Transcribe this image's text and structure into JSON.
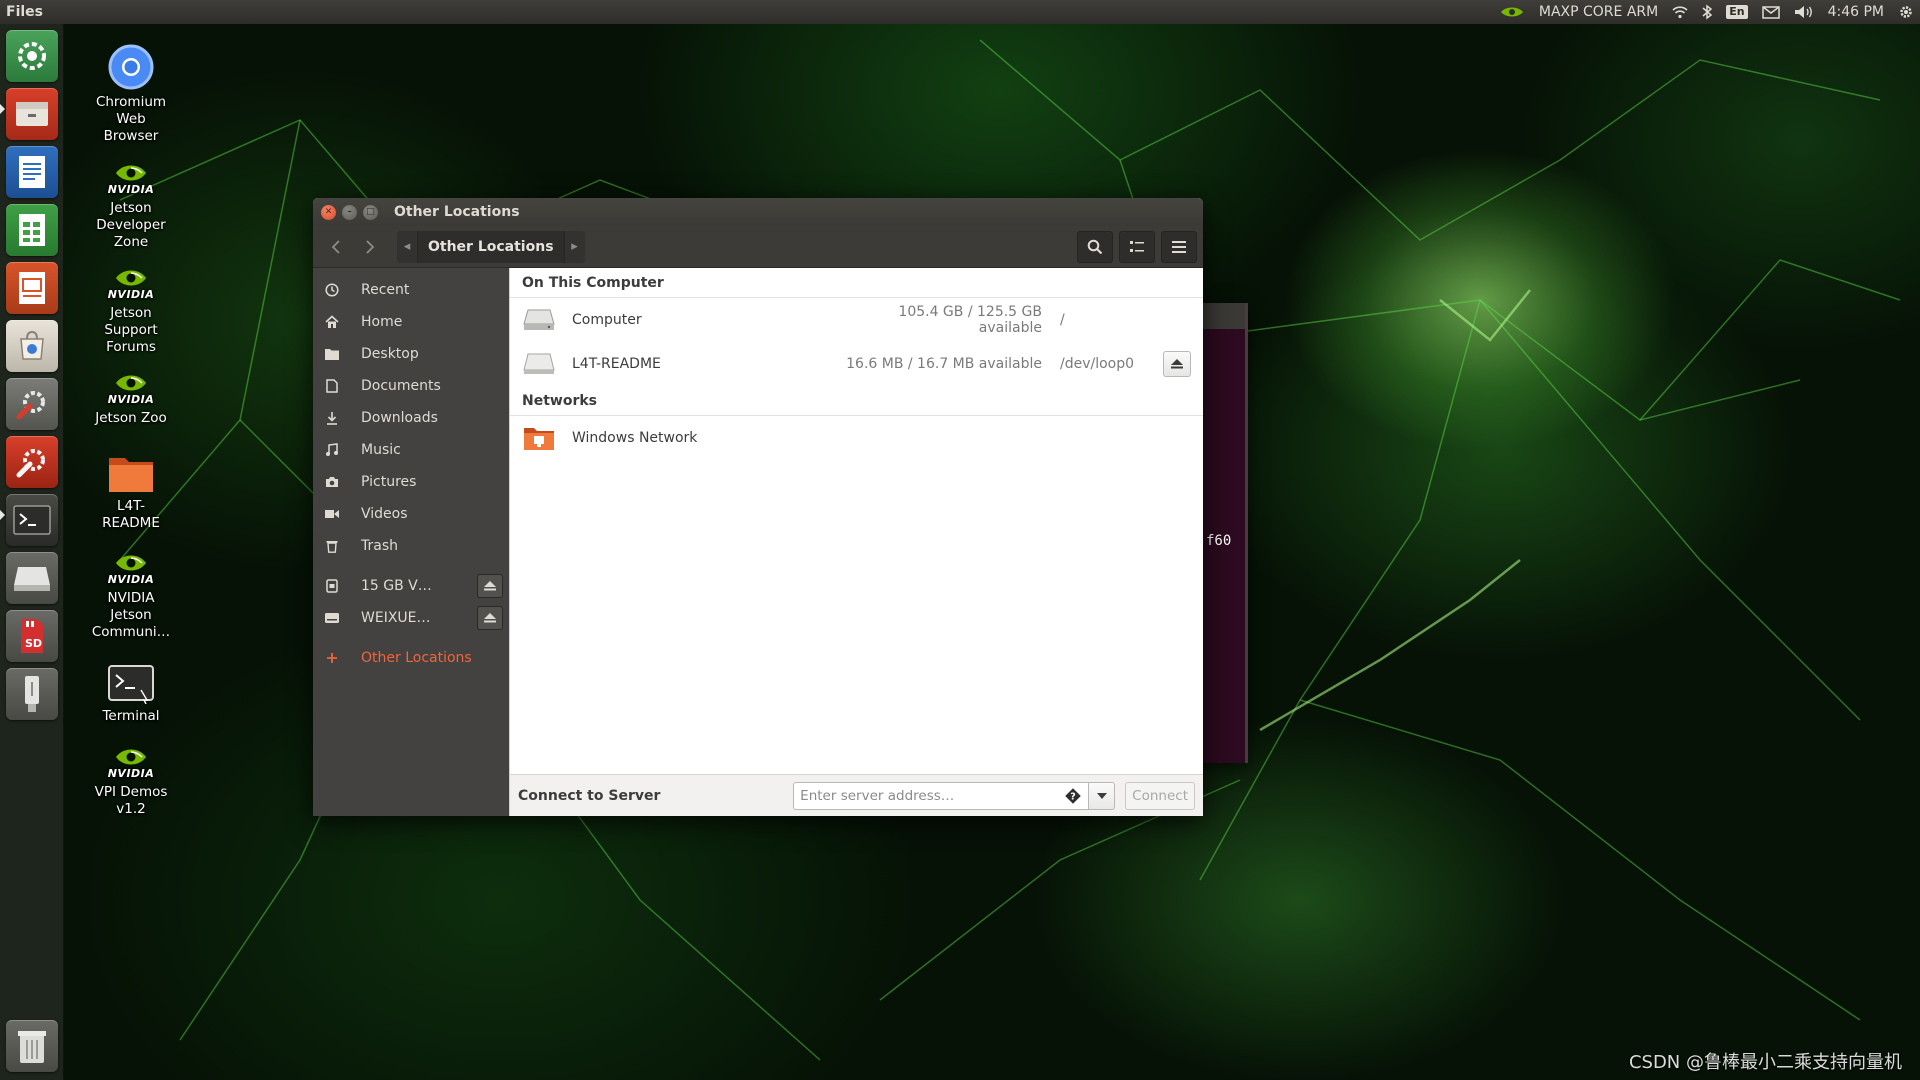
{
  "top_panel": {
    "app_name": "Files",
    "power_mode": "MAXP CORE ARM",
    "keyboard_layout": "En",
    "clock": "4:46 PM"
  },
  "launcher": {
    "items": [
      "system-settings-icon",
      "file-manager-icon",
      "writer-icon",
      "calc-icon",
      "impress-icon",
      "software-center-icon",
      "settings-tools-icon",
      "update-tools-icon",
      "terminal-icon",
      "drive-icon",
      "sd-card-icon",
      "usb-drive-icon",
      "trash-icon"
    ]
  },
  "desktop": {
    "icons": [
      {
        "label": "Chromium Web Browser",
        "icon": "chromium-icon"
      },
      {
        "label": "NVIDIA Jetson Developer Zone",
        "icon": "nvidia-icon"
      },
      {
        "label": "NVIDIA Jetson Support Forums",
        "icon": "nvidia-icon"
      },
      {
        "label": "NVIDIA Jetson Zoo",
        "icon": "nvidia-icon"
      },
      {
        "label": "L4T-README",
        "icon": "folder-icon"
      },
      {
        "label": "NVIDIA NVIDIA Jetson Communi…",
        "icon": "nvidia-icon"
      },
      {
        "label": "Terminal",
        "icon": "terminal-icon"
      },
      {
        "label": "NVIDIA VPI Demos v1.2",
        "icon": "nvidia-icon"
      }
    ],
    "nvidia_word": "NVIDIA",
    "chromium_lines": [
      "Chromium",
      "Web",
      "Browser"
    ],
    "devzone_lines": [
      "Jetson",
      "Developer",
      "Zone"
    ],
    "forums_lines": [
      "Jetson",
      "Support",
      "Forums"
    ],
    "zoo_lines": [
      "Jetson Zoo"
    ],
    "readme_lines": [
      "L4T-",
      "README"
    ],
    "community_lines": [
      "NVIDIA",
      "Jetson",
      "Communi…"
    ],
    "terminal_lines": [
      "Terminal"
    ],
    "vpi_lines": [
      "VPI Demos",
      "v1.2"
    ]
  },
  "bg_terminal": {
    "visible_text": "f60"
  },
  "window": {
    "title": "Other Locations",
    "path_crumb": "Other Locations",
    "sidebar": {
      "items": [
        {
          "label": "Recent",
          "icon": "clock-icon"
        },
        {
          "label": "Home",
          "icon": "home-icon"
        },
        {
          "label": "Desktop",
          "icon": "folder-icon"
        },
        {
          "label": "Documents",
          "icon": "document-icon"
        },
        {
          "label": "Downloads",
          "icon": "download-icon"
        },
        {
          "label": "Music",
          "icon": "music-icon"
        },
        {
          "label": "Pictures",
          "icon": "camera-icon"
        },
        {
          "label": "Videos",
          "icon": "video-icon"
        },
        {
          "label": "Trash",
          "icon": "trash-icon"
        }
      ],
      "devices": [
        {
          "label": "15 GB V…",
          "icon": "drive-icon"
        },
        {
          "label": "WEIXUE…",
          "icon": "drive-icon"
        }
      ],
      "other_locations": "Other Locations"
    },
    "sections": {
      "on_this_computer": "On This Computer",
      "networks": "Networks"
    },
    "locations": [
      {
        "name": "Computer",
        "available": "105.4 GB / 125.5 GB available",
        "path": "/"
      },
      {
        "name": "L4T-README",
        "available": "16.6 MB / 16.7 MB available",
        "path": "/dev/loop0"
      }
    ],
    "network_locations": [
      {
        "name": "Windows Network"
      }
    ],
    "connect": {
      "label": "Connect to Server",
      "placeholder": "Enter server address…",
      "button": "Connect"
    }
  },
  "watermark": "CSDN @鲁棒最小二乘支持向量机",
  "colors": {
    "accent": "#f0653c",
    "panel": "#3c3b37",
    "sidebar": "#434240"
  }
}
